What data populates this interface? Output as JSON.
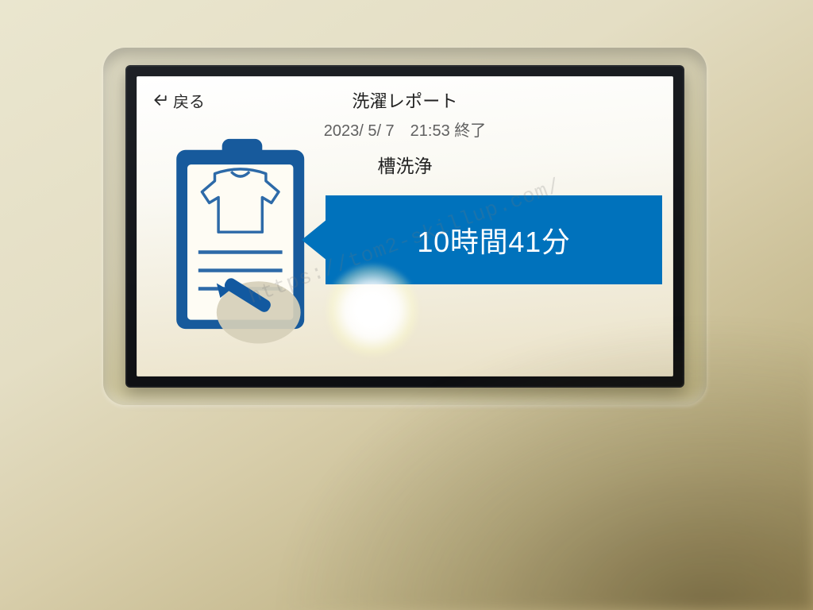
{
  "nav": {
    "back_label": "戻る"
  },
  "report": {
    "title": "洗濯レポート",
    "timestamp": "2023/ 5/ 7　21:53 終了",
    "cycle_name": "槽洗浄",
    "duration": "10時間41分"
  },
  "icons": {
    "back": "back-arrow-icon",
    "clipboard": "clipboard-report-icon"
  },
  "colors": {
    "accent": "#0072bc",
    "text": "#222222",
    "muted": "#606060",
    "screen_bg": "#faf9f3"
  },
  "watermark": "https://tom2-skillup.com/"
}
